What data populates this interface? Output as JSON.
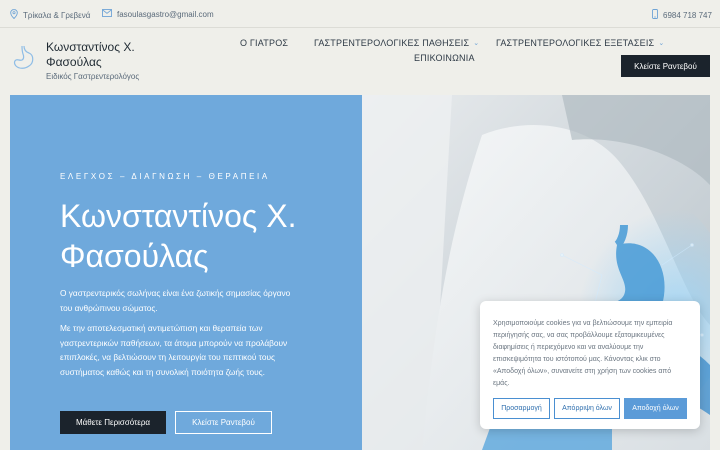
{
  "topbar": {
    "location": "Τρίκαλα & Γρεβενά",
    "email": "fasoulasgastro@gmail.com",
    "phone": "6984 718 747"
  },
  "header": {
    "name": "Κωνσταντίνος Χ. Φασούλας",
    "subtitle": "Ειδικός Γαστρεντερολόγος",
    "cta": "Κλείστε Ραντεβού"
  },
  "nav": {
    "items": [
      {
        "label": "Ο ΓΙΑΤΡΟΣ",
        "has_submenu": false
      },
      {
        "label": "ΓΑΣΤΡΕΝΤΕΡΟΛΟΓΙΚΕΣ ΠΑΘΗΣΕΙΣ",
        "has_submenu": true
      },
      {
        "label": "ΓΑΣΤΡΕΝΤΕΡΟΛΟΓΙΚΕΣ ΕΞΕΤΑΣΕΙΣ",
        "has_submenu": true
      },
      {
        "label": "ΕΠΙΚΟΙΝΩΝΙΑ",
        "has_submenu": false
      }
    ]
  },
  "hero": {
    "eyebrow": "ΕΛΕΓΧΟΣ – ΔΙΑΓΝΩΣΗ – ΘΕΡΑΠΕΙΑ",
    "title": "Κωνσταντίνος Χ. Φασούλας",
    "paragraph1": "Ο γαστρεντερικός σωλήνας είναι ένα ζωτικής σημασίας όργανο του ανθρώπινου σώματος.",
    "paragraph2": "Με την αποτελεσματική αντιμετώπιση και θεραπεία των γαστρεντερικών παθήσεων, τα άτομα μπορούν να προλάβουν επιπλοκές, να βελτιώσουν τη λειτουργία του πεπτικού τους συστήματος καθώς και τη συνολική ποιότητα ζωής τους.",
    "learn_more": "Μάθετε Περισσότερα",
    "book": "Κλείστε Ραντεβού"
  },
  "cookie": {
    "text": "Χρησιμοποιούμε cookies για να βελτιώσουμε την εμπειρία περιήγησής σας, να σας προβάλλουμε εξατομικευμένες διαφημίσεις ή περιεχόμενο και να αναλύουμε την επισκεψιμότητα του ιστότοπού μας. Κάνοντας κλικ στο «Αποδοχή όλων», συναινείτε στη χρήση των cookies από εμάς.",
    "customize": "Προσαρμογή",
    "reject": "Απόρριψη όλων",
    "accept": "Αποδοχή όλων"
  },
  "colors": {
    "accent": "#6fa9dc",
    "dark": "#1b232c",
    "background": "#efefea"
  },
  "icons": {
    "location": "map-pin-icon",
    "email": "envelope-icon",
    "phone": "phone-icon",
    "logo": "stomach-icon"
  }
}
